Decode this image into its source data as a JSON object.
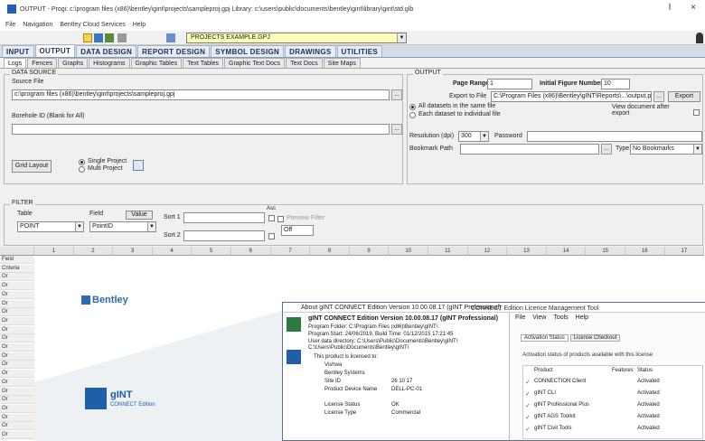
{
  "window": {
    "title": "OUTPUT - Progi: c:\\program files (x86)\\bentley\\gint\\projects\\sampleproj.gpj  Library: c:\\users\\public\\documents\\bentley\\gint\\library\\gint\\std.glb",
    "minimize": "ǀ",
    "close": "×"
  },
  "menu": {
    "items": [
      "File",
      "Navigation",
      "Bentley Cloud Services",
      "Help"
    ]
  },
  "toolbar": {
    "project_combo": "PROJECTS EXAMPLE.GPJ"
  },
  "main_tabs": [
    {
      "label": "INPUT"
    },
    {
      "label": "OUTPUT"
    },
    {
      "label": "DATA DESIGN"
    },
    {
      "label": "REPORT DESIGN"
    },
    {
      "label": "SYMBOL DESIGN"
    },
    {
      "label": "DRAWINGS"
    },
    {
      "label": "UTILITIES"
    }
  ],
  "sub_tabs": [
    {
      "label": "Logs"
    },
    {
      "label": "Fences"
    },
    {
      "label": "Graphs"
    },
    {
      "label": "Histograms"
    },
    {
      "label": "Graphic Tables"
    },
    {
      "label": "Text Tables"
    },
    {
      "label": "Graphic Text Docs"
    },
    {
      "label": "Text Docs"
    },
    {
      "label": "Site Maps"
    }
  ],
  "data_source": {
    "title": "DATA SOURCE",
    "source_file_label": "Source File",
    "source_file_value": "c:\\program files (x86)\\bentley\\gint\\projects\\sampleproj.gpj",
    "borehole_label": "Borehole ID  (Blank for All)",
    "borehole_value": "",
    "browse": "...",
    "grid_layout_button": "Grid Layout",
    "single_project": "Single Project",
    "multi_project": "Multi Project"
  },
  "output": {
    "title": "OUTPUT",
    "page_range_label": "Page Range",
    "page_range_value": "1",
    "initial_figure_label": "Initial Figure Number",
    "initial_figure_value": "10",
    "export_to_file_label": "Export to File",
    "export_to_file_value": "C:\\Program Files (x86)\\Bentley\\gINT\\Reports\\...\\output.pdf",
    "export_button": "Export",
    "all_datasets": "All datasets in the same file",
    "each_dataset": "Each dataset to individual file",
    "view_document": "View document after export",
    "resolution_label": "Resolution (dpi)",
    "resolution_value": "300",
    "password_label": "Password",
    "bookmark_path_label": "Bookmark Path",
    "type_label": "Type",
    "bookmark_type": "No Bookmarks"
  },
  "filter": {
    "title": "FILTER",
    "table_label": "Table",
    "table_value": "POINT",
    "field_label": "Field",
    "field_value": "PointID",
    "value_label": "Value",
    "sort1_label": "Sort 1",
    "sort2_label": "Sort 2",
    "asc_label": "Asc",
    "preview_filter_label": "Preview Filter",
    "off_value": "Off"
  },
  "grid": {
    "columns": [
      "1",
      "2",
      "3",
      "4",
      "5",
      "6",
      "7",
      "8",
      "9",
      "10",
      "11",
      "12",
      "13",
      "14",
      "15",
      "16",
      "17"
    ],
    "rows": [
      "Field",
      "Criteria",
      "Or",
      "Or",
      "Or",
      "Or",
      "Or",
      "Or",
      "Or",
      "Or",
      "Or",
      "Or",
      "Or",
      "Or",
      "Or",
      "Or",
      "Or",
      "Or",
      "Or",
      "Or",
      "Or"
    ]
  },
  "splash": {
    "brand": "Bentley",
    "product": "gINT",
    "edition": "CONNECT Edition"
  },
  "about": {
    "title": "About gINT CONNECT Edition Version 10.00.08.17 (gINT Professional)",
    "ims_title": "CONNECT Edition Licence Management Tool",
    "heading": "gINT CONNECT Edition Version 10.00.08.17 (gINT Professional)",
    "program_folder": "Program Folder: C:\\Program Files (x86)\\Bentley\\gINT\\",
    "program_start": "Program Start: 24/06/2019, Build Time: 01/12/2015 17:21:45",
    "user_data": "User data directory: C:\\Users\\Public\\Documents\\Bentley\\gINT\\",
    "user_data_2": "C:\\Users\\Public\\Documents\\Bentley\\gINT\\",
    "licensed_to": "This product is licensed to:",
    "fields": [
      {
        "k": "Vishwa",
        "v": ""
      },
      {
        "k": "Bentley Systems",
        "v": ""
      },
      {
        "k": "Site ID",
        "v": "26 10 17"
      },
      {
        "k": "Product Device Name",
        "v": "DELL-PC-01"
      },
      {
        "k": "License Status",
        "v": "OK"
      },
      {
        "k": "License Type",
        "v": "Commercial"
      }
    ],
    "menu": [
      "File",
      "View",
      "Tools",
      "Help"
    ],
    "tabs": [
      "Activation Status",
      "License Checkout"
    ],
    "status_note": "Activation status of products available with this license",
    "cols": [
      "Product",
      "Features",
      "Status"
    ],
    "products": [
      {
        "name": "CONNECTION Client",
        "status": "Activated"
      },
      {
        "name": "gINT CLI",
        "status": "Activated"
      },
      {
        "name": "gINT Professional Plus",
        "status": "Activated"
      },
      {
        "name": "gINT AGS Toolkit",
        "status": "Activated"
      },
      {
        "name": "gINT Civil Tools",
        "status": "Activated"
      }
    ]
  }
}
